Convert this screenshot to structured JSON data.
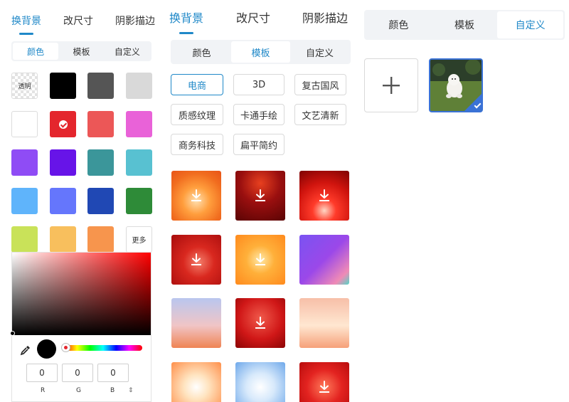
{
  "panel1": {
    "tabs": [
      "换背景",
      "改尺寸",
      "阴影描边"
    ],
    "segments": [
      "颜色",
      "模板",
      "自定义"
    ],
    "transparent_label": "透明",
    "swatches": [
      "#000000",
      "#555555",
      "#d9d9d9",
      "#ffffff",
      "#e4262d",
      "#ec5757",
      "#e962d8",
      "#8f4cf5",
      "#6714e8",
      "#3b969a",
      "#58c1d1",
      "#5fb4fb",
      "#6576fc",
      "#2048b4",
      "#2e8b38",
      "#c9e259",
      "#f8bf5d",
      "#f7954d"
    ],
    "selected_color": "#e4262d",
    "more_label": "更多",
    "picker": {
      "r": "0",
      "g": "0",
      "b": "0",
      "r_label": "R",
      "g_label": "G",
      "b_label": "B",
      "mode_icon": "⇕",
      "preview_color": "#000000",
      "hue_color": "#ff0000"
    }
  },
  "panel2": {
    "tabs": [
      "换背景",
      "改尺寸",
      "阴影描边"
    ],
    "segments": [
      "颜色",
      "模板",
      "自定义"
    ],
    "tags": [
      "电商",
      "3D",
      "复古国风",
      "质感纹理",
      "卡通手绘",
      "文艺清新",
      "商务科技",
      "扁平简约"
    ],
    "active_tag": "电商",
    "templates": [
      {
        "theme": "orange-sunburst",
        "download_icon": true
      },
      {
        "theme": "dark-red-stage",
        "download_icon": true
      },
      {
        "theme": "red-light-rays",
        "download_icon": true
      },
      {
        "theme": "red-tunnel",
        "download_icon": true
      },
      {
        "theme": "orange-hexagon",
        "download_icon": true
      },
      {
        "theme": "purple-gradient",
        "download_icon": false
      },
      {
        "theme": "sky-stage",
        "download_icon": false
      },
      {
        "theme": "red-podium",
        "download_icon": true
      },
      {
        "theme": "peach-stage",
        "download_icon": false
      },
      {
        "theme": "orange-window",
        "download_icon": false
      },
      {
        "theme": "blue-curtain",
        "download_icon": false
      },
      {
        "theme": "red-circle",
        "download_icon": true
      }
    ]
  },
  "panel3": {
    "segments": [
      "颜色",
      "模板",
      "自定义"
    ],
    "add_icon": "plus-icon",
    "uploaded_image": "white-dog-on-grass",
    "selected_icon": "check-icon"
  },
  "colors": {
    "accent": "#1f88c8",
    "selected_border": "#3a72d6"
  }
}
